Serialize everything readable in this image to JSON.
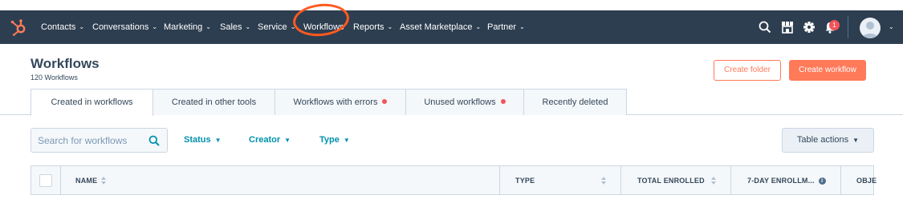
{
  "nav": {
    "items": [
      {
        "label": "Contacts"
      },
      {
        "label": "Conversations"
      },
      {
        "label": "Marketing"
      },
      {
        "label": "Sales"
      },
      {
        "label": "Service"
      },
      {
        "label": "Workflows"
      },
      {
        "label": "Reports"
      },
      {
        "label": "Asset Marketplace"
      },
      {
        "label": "Partner"
      }
    ],
    "notification_count": "1",
    "icons": [
      "hubspot-sprocket-icon",
      "search-icon",
      "marketplace-icon",
      "gear-icon",
      "bell-icon",
      "avatar"
    ]
  },
  "page": {
    "title": "Workflows",
    "count": "120 Workflows",
    "create_folder_label": "Create folder",
    "create_workflow_label": "Create workflow"
  },
  "tabs": [
    {
      "label": "Created in workflows",
      "active": true
    },
    {
      "label": "Created in other tools"
    },
    {
      "label": "Workflows with errors",
      "dot": true
    },
    {
      "label": "Unused workflows",
      "dot": true
    },
    {
      "label": "Recently deleted"
    }
  ],
  "filters": {
    "search_placeholder": "Search for workflows",
    "status_label": "Status",
    "creator_label": "Creator",
    "type_label": "Type",
    "table_actions_label": "Table actions"
  },
  "table": {
    "columns": [
      "NAME",
      "TYPE",
      "TOTAL ENROLLED",
      "7-DAY ENROLLM...",
      "OBJE"
    ]
  },
  "colors": {
    "nav_bg": "#2d3e50",
    "accent_orange": "#ff7a59",
    "link_teal": "#0091ae",
    "alert_red": "#f2545b",
    "annotation_ring": "#ff5a1f"
  }
}
